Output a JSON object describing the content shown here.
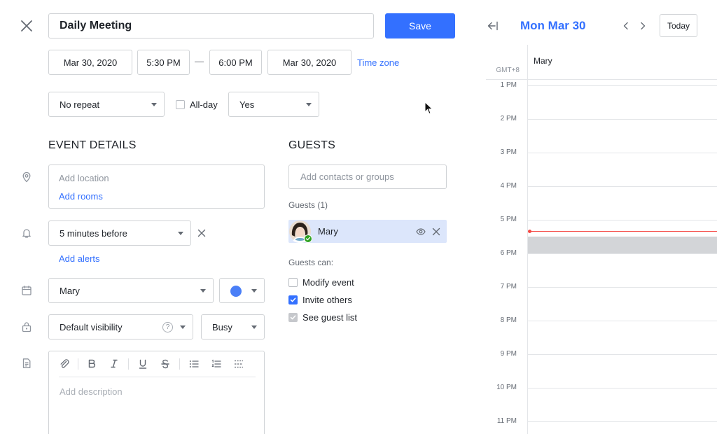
{
  "header": {
    "title_value": "Daily Meeting",
    "save_label": "Save"
  },
  "datetime": {
    "start_date": "Mar 30, 2020",
    "start_time": "5:30 PM",
    "separator": "—",
    "end_time": "6:00 PM",
    "end_date": "Mar 30, 2020",
    "timezone_label": "Time zone"
  },
  "options": {
    "repeat_value": "No repeat",
    "allday_label": "All-day",
    "third_select_value": "Yes"
  },
  "event_details": {
    "heading": "EVENT DETAILS",
    "location_placeholder": "Add location",
    "add_rooms_label": "Add rooms",
    "alert_value": "5 minutes before",
    "add_alerts_label": "Add alerts",
    "calendar_value": "Mary",
    "calendar_color": "#4a7ff7",
    "visibility_value": "Default visibility",
    "visibility_help": "?",
    "busy_value": "Busy",
    "description_placeholder": "Add description"
  },
  "guests": {
    "heading": "GUESTS",
    "add_placeholder": "Add contacts or groups",
    "count_label": "Guests (1)",
    "list": [
      {
        "name": "Mary"
      }
    ],
    "can_label": "Guests can:",
    "permissions": [
      {
        "label": "Modify event",
        "state": "off"
      },
      {
        "label": "Invite others",
        "state": "on"
      },
      {
        "label": "See guest list",
        "state": "locked"
      }
    ]
  },
  "calendar_pane": {
    "date_title": "Mon Mar 30",
    "today_label": "Today",
    "timezone": "GMT+8",
    "column_name": "Mary",
    "hours": [
      "1 PM",
      "2 PM",
      "3 PM",
      "4 PM",
      "5 PM",
      "6 PM",
      "7 PM",
      "8 PM",
      "9 PM",
      "10 PM",
      "11 PM"
    ],
    "accent_color": "#3370ff",
    "now_line_color": "#f54a45"
  }
}
